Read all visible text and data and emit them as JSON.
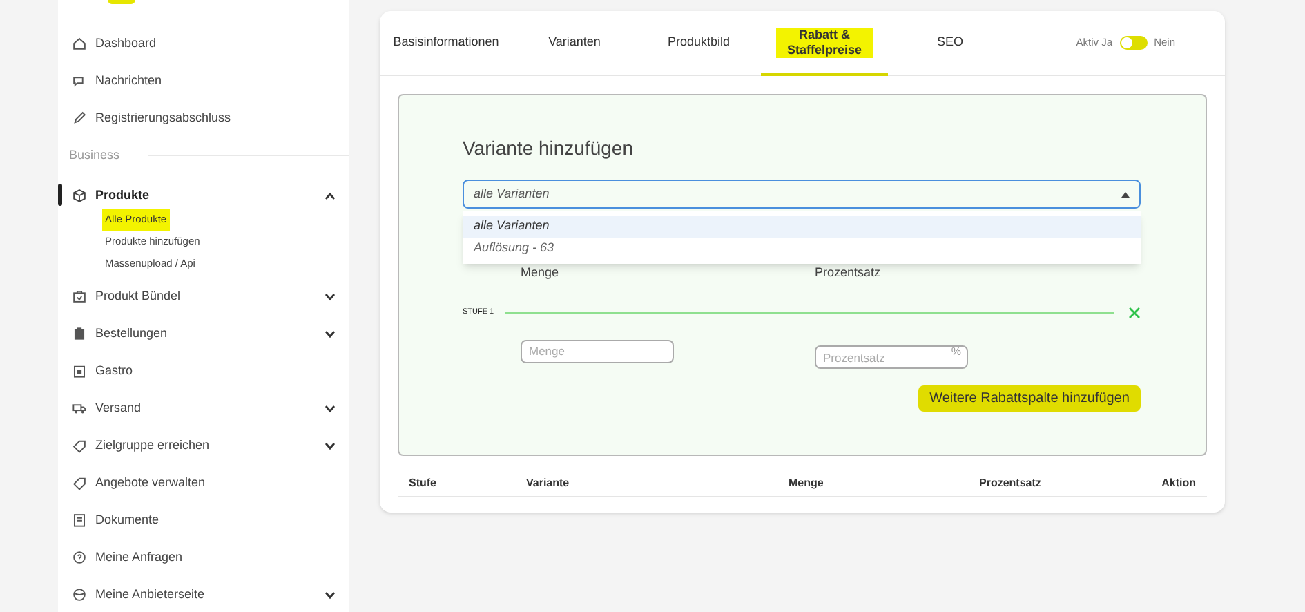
{
  "sidebar": {
    "items": [
      {
        "kind": "link",
        "label": "Dashboard",
        "selected": false
      },
      {
        "kind": "link",
        "label": "Nachrichten",
        "selected": false
      },
      {
        "kind": "link",
        "label": "Registrierungsabschluss",
        "selected": false
      },
      {
        "kind": "section",
        "label": "Business"
      },
      {
        "kind": "link",
        "label": "Produkte",
        "selected": true,
        "expanded": true,
        "children": [
          {
            "label": "Alle Produkte",
            "selected": true
          },
          {
            "label": "Produkte hinzufügen",
            "selected": false
          },
          {
            "label": "Massenupload / Api",
            "selected": false
          }
        ]
      },
      {
        "kind": "link",
        "label": "Produkt Bündel",
        "selected": false,
        "expanded": false
      },
      {
        "kind": "link",
        "label": "Bestellungen",
        "selected": false,
        "expanded": false
      },
      {
        "kind": "link",
        "label": "Gastro",
        "selected": false
      },
      {
        "kind": "link",
        "label": "Versand",
        "selected": false,
        "expanded": false
      },
      {
        "kind": "link",
        "label": "Zielgruppe erreichen",
        "selected": false,
        "expanded": false
      },
      {
        "kind": "link",
        "label": "Angebote verwalten",
        "selected": false
      },
      {
        "kind": "link",
        "label": "Dokumente",
        "selected": false
      },
      {
        "kind": "link",
        "label": "Meine Anfragen",
        "selected": false
      },
      {
        "kind": "link",
        "label": "Meine Anbieterseite",
        "selected": false,
        "expanded": false
      }
    ]
  },
  "tabs": [
    {
      "label": "Basisinformationen",
      "selected": false
    },
    {
      "label": "Varianten",
      "selected": false
    },
    {
      "label": "Produktbild",
      "selected": false
    },
    {
      "label": "Rabatt & Staffelpreise",
      "selected": true
    },
    {
      "label": "SEO",
      "selected": false
    }
  ],
  "active_toggle": {
    "label_on": "Aktiv Ja",
    "label_off": "Nein",
    "on": false
  },
  "form": {
    "title": "Variante hinzufügen",
    "variant_select": {
      "value": "alle Varianten",
      "expanded": true,
      "options": [
        {
          "label": "alle Varianten",
          "selected": true
        },
        {
          "label": "Auflösung - 63",
          "selected": false
        }
      ]
    },
    "column_labels": [
      "Menge",
      "Prozentsatz"
    ],
    "tiers": [
      {
        "label": "STUFE 1",
        "quantity": {
          "placeholder": "Menge"
        },
        "percent": {
          "placeholder": "Prozentsatz",
          "suffix": "%"
        }
      }
    ],
    "add_button": "Weitere Rabattspalte hinzufügen"
  },
  "table": {
    "columns": [
      "Stufe",
      "Variante",
      "Menge",
      "Prozentsatz",
      "Aktion"
    ]
  }
}
